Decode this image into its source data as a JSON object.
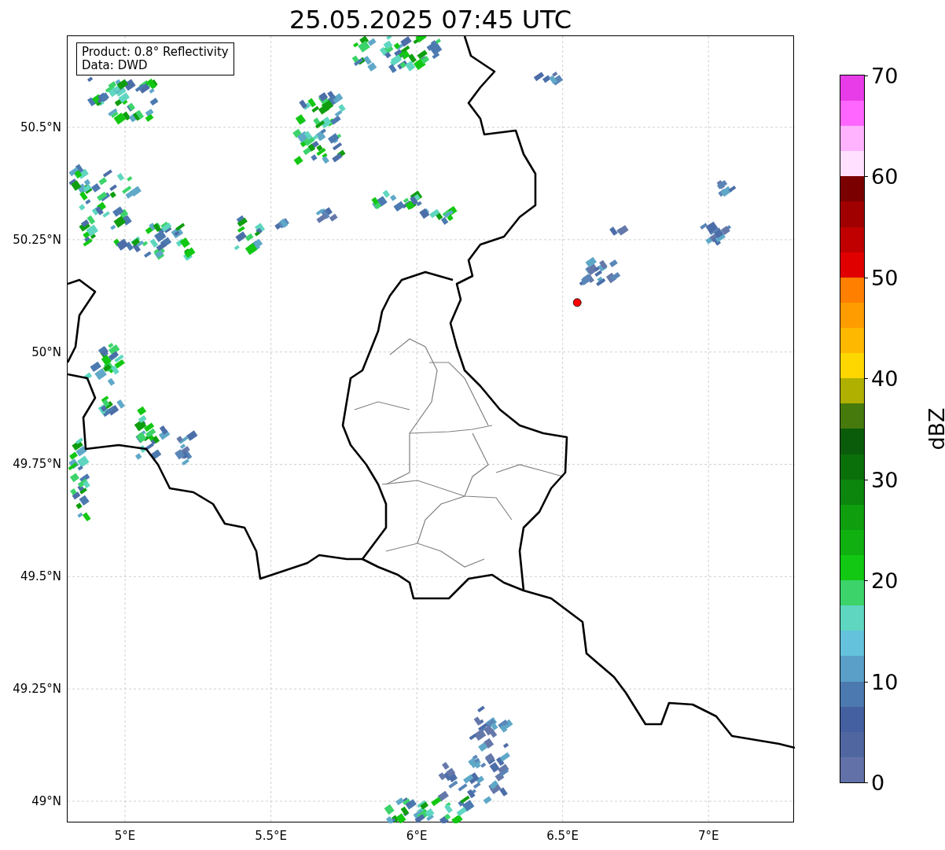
{
  "title": "25.05.2025 07:45 UTC",
  "legend": [
    "Product: 0.8° Reflectivity",
    "Data: DWD"
  ],
  "map": {
    "yticks": [
      "50.5°N",
      "50.25°N",
      "50°N",
      "49.75°N",
      "49.5°N",
      "49.25°N",
      "49°N"
    ],
    "xticks": [
      "5°E",
      "5.5°E",
      "6°E",
      "6.5°E",
      "7°E"
    ]
  },
  "colorbar": {
    "label": "dBZ",
    "ticks": [
      "70",
      "60",
      "50",
      "40",
      "30",
      "20",
      "10",
      "0"
    ],
    "segments": [
      {
        "color": "#6272a8"
      },
      {
        "color": "#5066a0"
      },
      {
        "color": "#4460a0"
      },
      {
        "color": "#4c7ab0"
      },
      {
        "color": "#5a9fc8"
      },
      {
        "color": "#64c2dc"
      },
      {
        "color": "#5fd6c0"
      },
      {
        "color": "#3cd46a"
      },
      {
        "color": "#12c812"
      },
      {
        "color": "#10b010"
      },
      {
        "color": "#0e9e0e"
      },
      {
        "color": "#0c860c"
      },
      {
        "color": "#0a700a"
      },
      {
        "color": "#0a5c0a"
      },
      {
        "color": "#467a0c"
      },
      {
        "color": "#b0b000"
      },
      {
        "color": "#ffd700"
      },
      {
        "color": "#ffb800"
      },
      {
        "color": "#ff9c00"
      },
      {
        "color": "#ff8000"
      },
      {
        "color": "#e00000"
      },
      {
        "color": "#c00000"
      },
      {
        "color": "#a00000"
      },
      {
        "color": "#7a0000"
      },
      {
        "color": "#ffe0ff"
      },
      {
        "color": "#ffb3ff"
      },
      {
        "color": "#ff66ff"
      },
      {
        "color": "#e83ce8"
      }
    ]
  }
}
